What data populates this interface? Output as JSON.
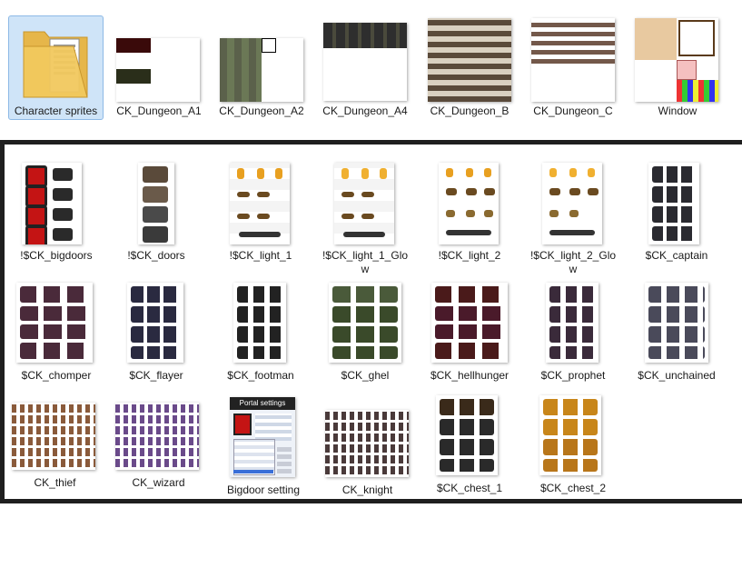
{
  "top_row": [
    {
      "label": "Character sprites",
      "icon": "folder-icon"
    },
    {
      "label": "CK_Dungeon_A1"
    },
    {
      "label": "CK_Dungeon_A2"
    },
    {
      "label": "CK_Dungeon_A4"
    },
    {
      "label": "CK_Dungeon_B"
    },
    {
      "label": "CK_Dungeon_C"
    },
    {
      "label": "Window"
    }
  ],
  "grid": {
    "row1": [
      {
        "label": "!$CK_bigdoors"
      },
      {
        "label": "!$CK_doors"
      },
      {
        "label": "!$CK_light_1"
      },
      {
        "label": "!$CK_light_1_Glow"
      },
      {
        "label": "!$CK_light_2"
      },
      {
        "label": "!$CK_light_2_Glow"
      },
      {
        "label": "$CK_captain"
      }
    ],
    "row2": [
      {
        "label": "$CK_chomper"
      },
      {
        "label": "$CK_flayer"
      },
      {
        "label": "$CK_footman"
      },
      {
        "label": "$CK_ghel"
      },
      {
        "label": "$CK_hellhunger"
      },
      {
        "label": "$CK_prophet"
      },
      {
        "label": "$CK_unchained"
      }
    ],
    "row3": [
      {
        "label": "CK_thief"
      },
      {
        "label": "CK_wizard"
      },
      {
        "label": "Bigdoor setting"
      },
      {
        "label": "CK_knight"
      },
      {
        "label": "$CK_chest_1"
      },
      {
        "label": "$CK_chest_2"
      }
    ]
  },
  "portal_settings": {
    "title": "Portal settings"
  },
  "colors": {
    "selection": "#cfe4f8",
    "panel_border": "#1f1f1f"
  }
}
